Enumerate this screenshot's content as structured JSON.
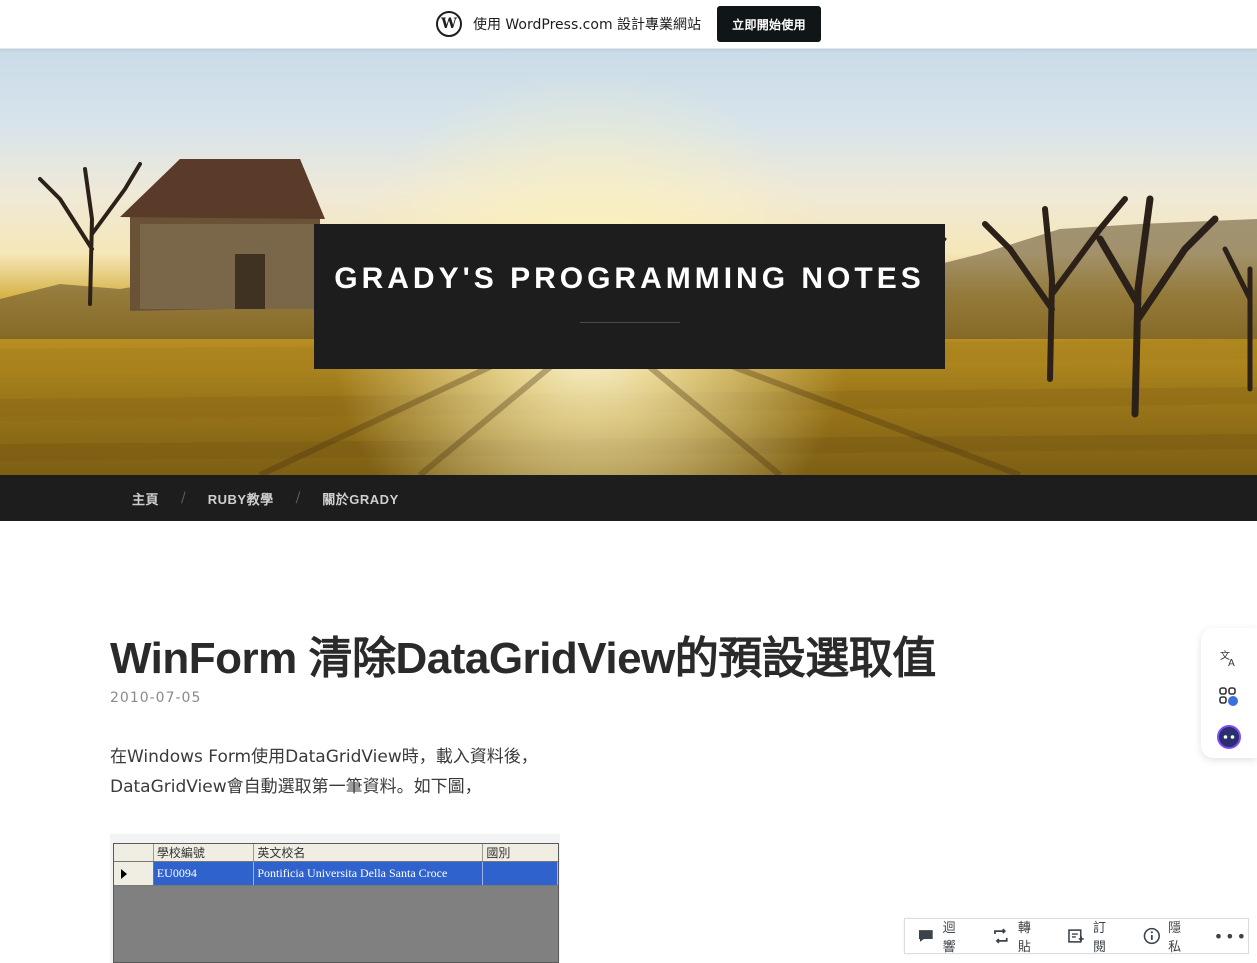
{
  "wp_banner": {
    "text": "使用 WordPress.com 設計專業網站",
    "cta_label": "立即開始使用"
  },
  "header": {
    "site_title": "GRADY'S PROGRAMMING NOTES"
  },
  "nav": {
    "items": [
      {
        "label": "主頁"
      },
      {
        "label": "RUBY教學"
      },
      {
        "label": "關於GRADY"
      }
    ],
    "separator": "/"
  },
  "post": {
    "title": "WinForm 清除DataGridView的預設選取值",
    "date": "2010-07-05",
    "body_line1": "在Windows Form使用DataGridView時，載入資料後，",
    "body_line2": "DataGridView會自動選取第一筆資料。如下圖，",
    "grid": {
      "headers": [
        "學校編號",
        "英文校名",
        "國別"
      ],
      "row": [
        "EU0094",
        "Pontificia Universita Della Santa Croce",
        ""
      ]
    }
  },
  "side_tools": [
    {
      "icon": "translate-icon"
    },
    {
      "icon": "apps-icon"
    },
    {
      "icon": "assistant-icon"
    }
  ],
  "action_bar": {
    "comment": "迴響",
    "reblog": "轉貼",
    "subscribe": "訂閱",
    "privacy": "隱私",
    "more": "•••"
  },
  "colors": {
    "banner_cta_bg": "#101517",
    "header_box_bg": "#1d1d1d",
    "nav_bg": "#1d1d1d",
    "grid_selection": "#2f62cd",
    "grid_empty": "#808080"
  }
}
